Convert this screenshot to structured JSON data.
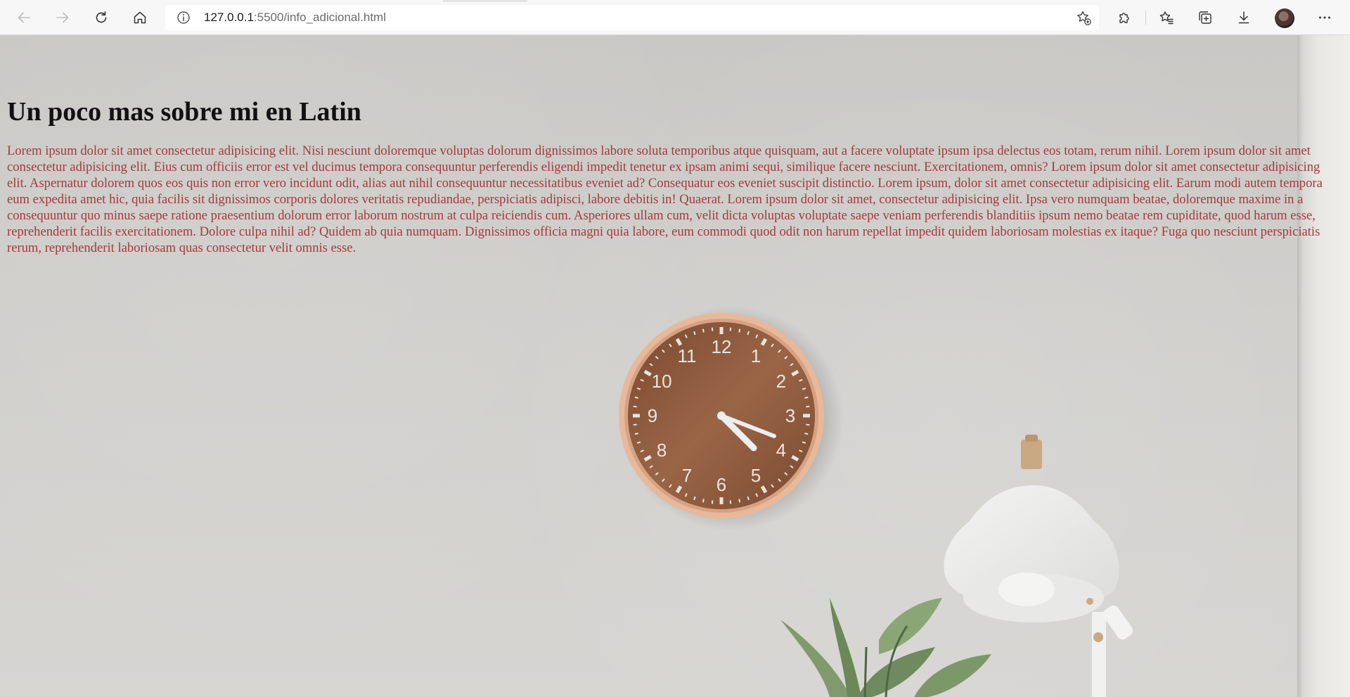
{
  "browser": {
    "url_host": "127.0.0.1",
    "url_rest": ":5500/info_adicional.html",
    "icons": {
      "back": "arrow-left-icon",
      "forward": "arrow-right-icon",
      "refresh": "refresh-icon",
      "home": "home-icon",
      "site_info": "info-icon",
      "add_favorite": "star-plus-icon",
      "extensions": "puzzle-icon",
      "favorites": "star-list-icon",
      "collections": "collections-icon",
      "downloads": "download-icon",
      "profile": "avatar",
      "menu": "more-icon"
    }
  },
  "page": {
    "title": "Un poco mas sobre mi en Latin",
    "paragraph": "Lorem ipsum dolor sit amet consectetur adipisicing elit. Nisi nesciunt doloremque voluptas dolorum dignissimos labore soluta temporibus atque quisquam, aut a facere voluptate ipsum ipsa delectus eos totam, rerum nihil. Lorem ipsum dolor sit amet consectetur adipisicing elit. Eius cum officiis error est vel ducimus tempora consequuntur perferendis eligendi impedit tenetur ex ipsam animi sequi, similique facere nesciunt. Exercitationem, omnis? Lorem ipsum dolor sit amet consectetur adipisicing elit. Aspernatur dolorem quos eos quis non error vero incidunt odit, alias aut nihil consequuntur necessitatibus eveniet ad? Consequatur eos eveniet suscipit distinctio. Lorem ipsum, dolor sit amet consectetur adipisicing elit. Earum modi autem tempora eum expedita amet hic, quia facilis sit dignissimos corporis dolores veritatis repudiandae, perspiciatis adipisci, labore debitis in! Quaerat. Lorem ipsum dolor sit amet, consectetur adipisicing elit. Ipsa vero numquam beatae, doloremque maxime in a consequuntur quo minus saepe ratione praesentium dolorum error laborum nostrum at culpa reiciendis cum. Asperiores ullam cum, velit dicta voluptas voluptate saepe veniam perferendis blanditiis ipsum nemo beatae rem cupiditate, quod harum esse, reprehenderit facilis exercitationem. Dolore culpa nihil ad? Quidem ab quia numquam. Dignissimos officia magni quia labore, eum commodi quod odit non harum repellat impedit quidem laboriosam molestias ex itaque? Fuga quo nesciunt perspiciatis rerum, reprehenderit laboriosam quas consectetur velit omnis esse.",
    "title_color": "#111111",
    "text_color": "#a33a3a"
  },
  "background": {
    "clock_numerals": [
      "12",
      "1",
      "2",
      "3",
      "4",
      "5",
      "6",
      "7",
      "8",
      "9",
      "10",
      "11"
    ],
    "clock_face_color": "#8a573a",
    "wall_color": "#cfcecb"
  }
}
